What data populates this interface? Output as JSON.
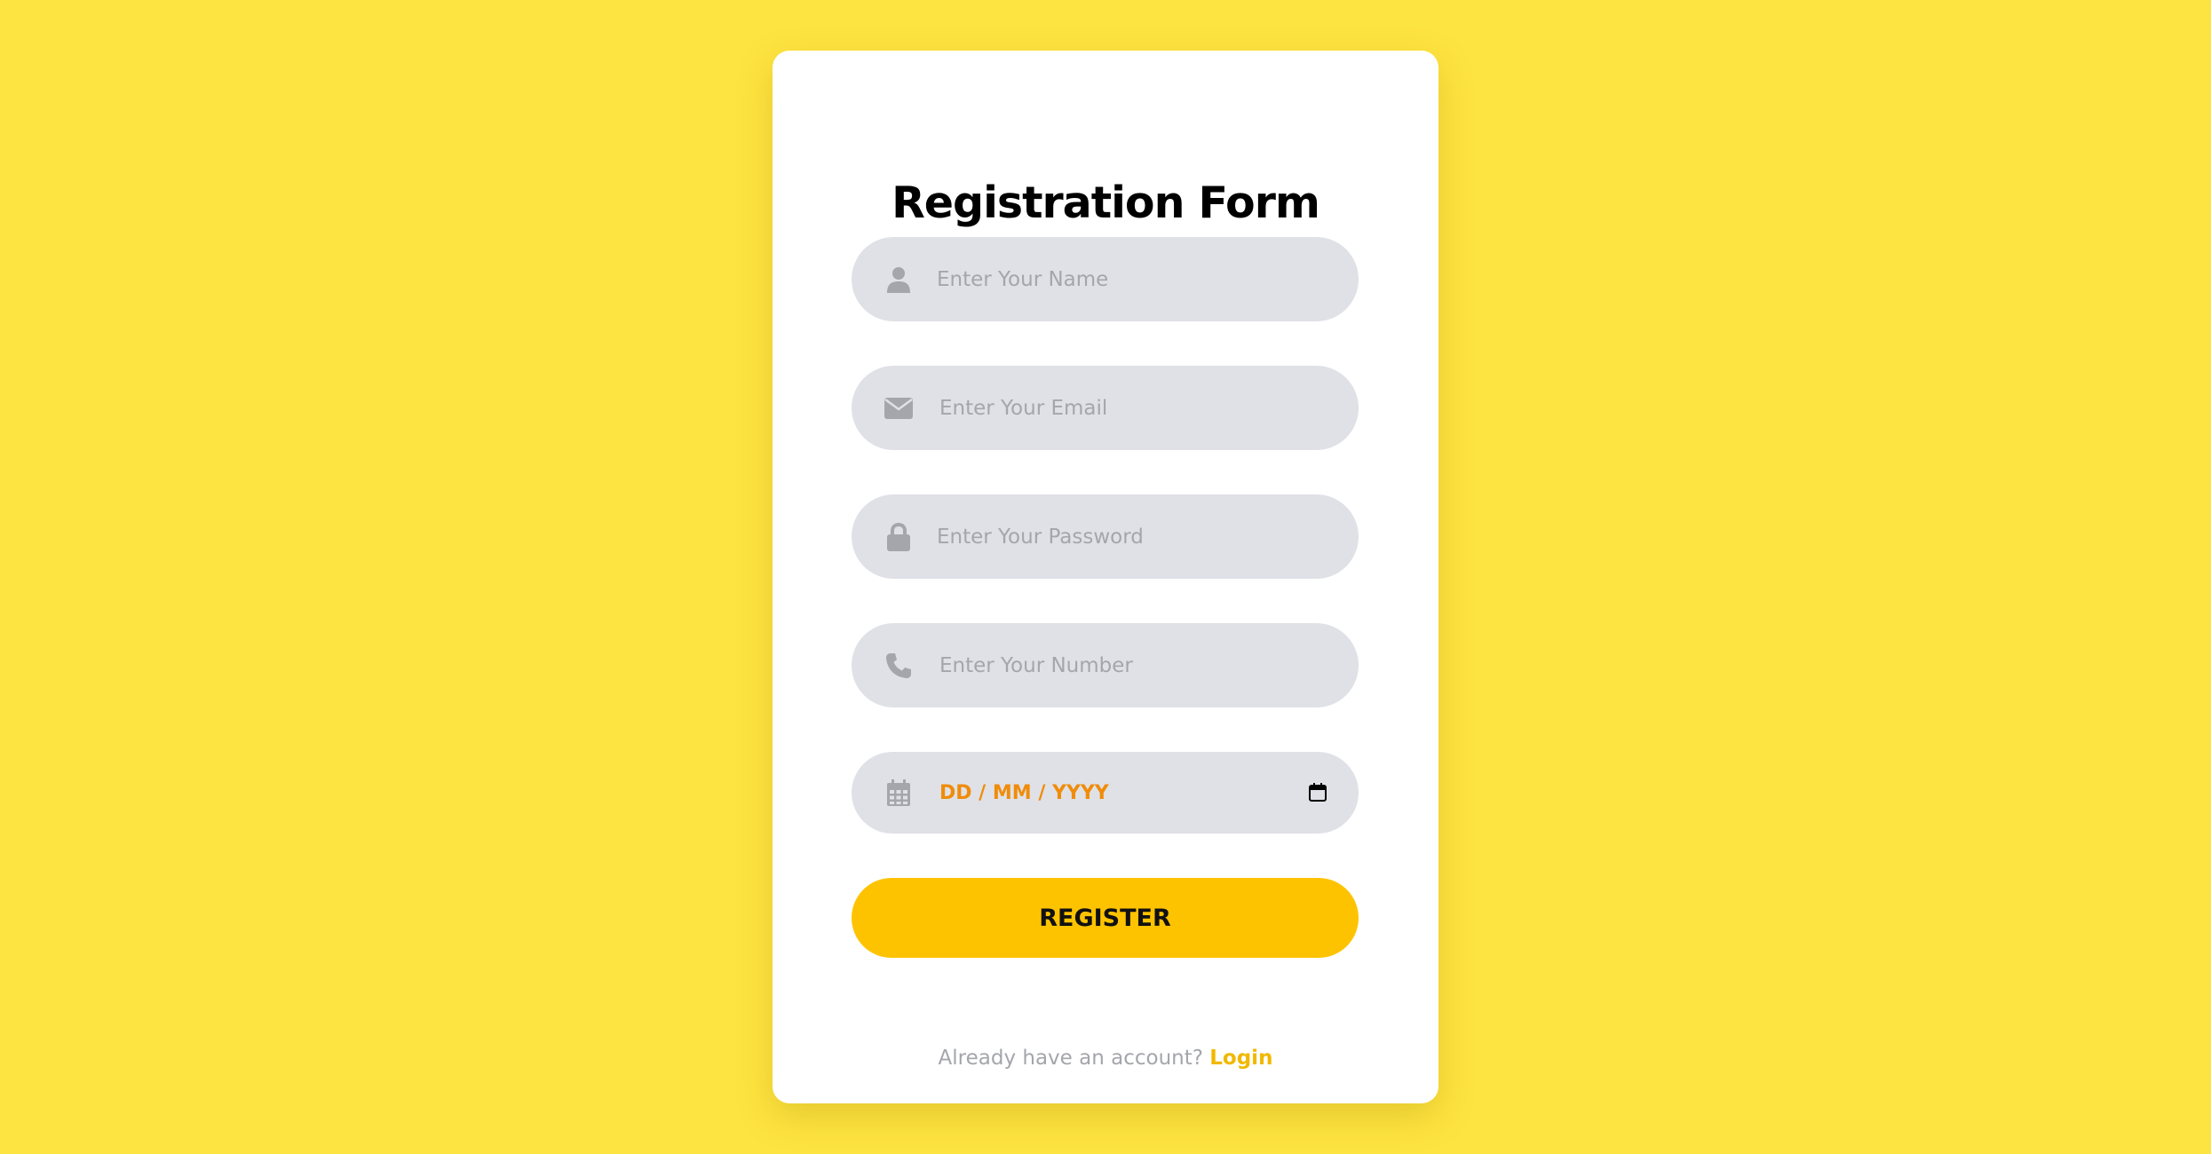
{
  "form": {
    "title": "Registration Form",
    "fields": [
      {
        "icon": "user-icon",
        "placeholder": "Enter Your Name"
      },
      {
        "icon": "envelope-icon",
        "placeholder": "Enter Your Email"
      },
      {
        "icon": "lock-icon",
        "placeholder": "Enter Your Password"
      },
      {
        "icon": "phone-icon",
        "placeholder": "Enter Your Number"
      },
      {
        "icon": "calendar-icon",
        "placeholder": "DD / MM / YYYY"
      }
    ],
    "register_label": "REGISTER",
    "footer_text": "Already have an account?",
    "login_label": "Login"
  },
  "colors": {
    "background": "#fee440",
    "card": "#ffffff",
    "field": "#dfe1e6",
    "placeholder": "#a4a6ab",
    "date_text": "#f08c0a",
    "button": "#fec300",
    "login_link": "#f1b800"
  }
}
